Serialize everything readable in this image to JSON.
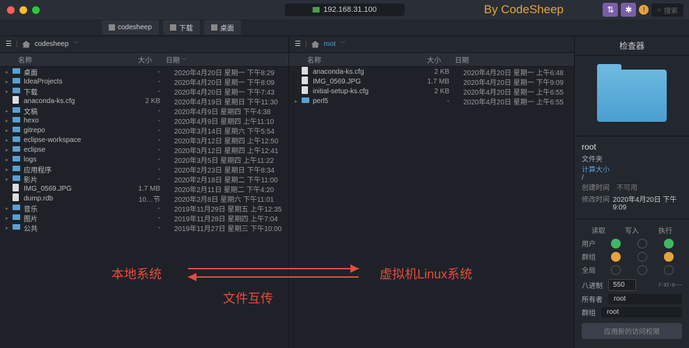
{
  "titlebar": {
    "host": "192.168.31.100",
    "watermark": "By CodeSheep",
    "search_placeholder": "搜索"
  },
  "tabs": [
    {
      "label": "codesheep"
    },
    {
      "label": "下载"
    },
    {
      "label": "桌面"
    }
  ],
  "left": {
    "crumb": "codesheep",
    "cols": {
      "name": "名称",
      "size": "大小",
      "date": "日期"
    },
    "rows": [
      {
        "t": "d",
        "n": "桌面",
        "s": "-",
        "d": "2020年4月20日 星期一 下午8:29"
      },
      {
        "t": "d",
        "n": "IdeaProjects",
        "s": "-",
        "d": "2020年4月20日 星期一 下午8:09"
      },
      {
        "t": "d",
        "n": "下载",
        "s": "-",
        "d": "2020年4月20日 星期一 下午7:43"
      },
      {
        "t": "f",
        "n": "anaconda-ks.cfg",
        "s": "2 KB",
        "d": "2020年4月19日 星期日 下午11:30"
      },
      {
        "t": "d",
        "n": "文稿",
        "s": "-",
        "d": "2020年4月9日 星期四 下午4:38"
      },
      {
        "t": "d",
        "n": "hexo",
        "s": "-",
        "d": "2020年4月9日 星期四 上午11:10"
      },
      {
        "t": "d",
        "n": "gitrepo",
        "s": "-",
        "d": "2020年3月14日 星期六 下午5:54"
      },
      {
        "t": "d",
        "n": "eclipse-workspace",
        "s": "-",
        "d": "2020年3月12日 星期四 上午12:50"
      },
      {
        "t": "d",
        "n": "eclipse",
        "s": "-",
        "d": "2020年3月12日 星期四 上午12:41"
      },
      {
        "t": "d",
        "n": "logs",
        "s": "-",
        "d": "2020年3月5日 星期四 上午11:22"
      },
      {
        "t": "d",
        "n": "应用程序",
        "s": "-",
        "d": "2020年2月23日 星期日 下午8:34"
      },
      {
        "t": "d",
        "n": "影片",
        "s": "-",
        "d": "2020年2月18日 星期二 下午11:00"
      },
      {
        "t": "f",
        "n": "IMG_0569.JPG",
        "s": "1.7 MB",
        "d": "2020年2月11日 星期二 下午4:20"
      },
      {
        "t": "f",
        "n": "dump.rdb",
        "s": "10…节",
        "d": "2020年2月8日 星期六 下午11:01"
      },
      {
        "t": "d",
        "n": "音乐",
        "s": "-",
        "d": "2019年11月29日 星期五 上午12:35"
      },
      {
        "t": "d",
        "n": "图片",
        "s": "-",
        "d": "2019年11月28日 星期四 上午7:04"
      },
      {
        "t": "d",
        "n": "公共",
        "s": "-",
        "d": "2019年11月27日 星期三 下午10:00"
      }
    ]
  },
  "right": {
    "crumb": "root",
    "cols": {
      "name": "名称",
      "size": "大小",
      "date": "日期"
    },
    "rows": [
      {
        "t": "f",
        "n": "anaconda-ks.cfg",
        "s": "2 KB",
        "d": "2020年4月20日 星期一 上午6:48"
      },
      {
        "t": "f",
        "n": "IMG_0569.JPG",
        "s": "1.7 MB",
        "d": "2020年4月20日 星期一 下午9:09"
      },
      {
        "t": "f",
        "n": "initial-setup-ks.cfg",
        "s": "2 KB",
        "d": "2020年4月20日 星期一 上午6:55"
      },
      {
        "t": "d",
        "n": "perl5",
        "s": "-",
        "d": "2020年4月20日 星期一 上午6:55"
      }
    ]
  },
  "inspector": {
    "title": "检查器",
    "name": "root",
    "kind": "文件夹",
    "size_label": "计算大小",
    "path": "/",
    "created_k": "创建时间",
    "created_v": "不可用",
    "modified_k": "修改时间",
    "modified_v": "2020年4月20日 下午9:09",
    "perm_read": "读取",
    "perm_write": "写入",
    "perm_exec": "执行",
    "perm_user": "用户",
    "perm_group": "群组",
    "perm_all": "全局",
    "octal_label": "八进制",
    "octal_value": "550",
    "rwx_label": "r-xr-x---",
    "owner_label": "所有者",
    "owner_value": "root",
    "group_label": "群组",
    "group_value": "root",
    "apply": "应用新的访问权限"
  },
  "annotations": {
    "local": "本地系统",
    "remote": "虚拟机Linux系统",
    "transfer": "文件互传"
  }
}
